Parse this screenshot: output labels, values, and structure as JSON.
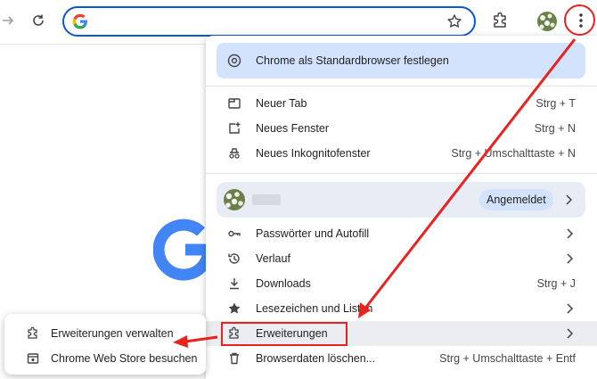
{
  "toolbar": {
    "omnibox_value": "",
    "icons": [
      "forward-icon",
      "reload-icon",
      "google-g-icon",
      "bookmark-star-icon",
      "extensions-icon",
      "profile-avatar",
      "more-menu-icon"
    ]
  },
  "menu": {
    "default_banner": "Chrome als Standardbrowser festlegen",
    "items_group1": [
      {
        "label": "Neuer Tab",
        "shortcut": "Strg + T",
        "icon": "new-tab-icon"
      },
      {
        "label": "Neues Fenster",
        "shortcut": "Strg + N",
        "icon": "new-window-icon"
      },
      {
        "label": "Neues Inkognitofenster",
        "shortcut": "Strg + Umschalttaste + N",
        "icon": "incognito-icon"
      }
    ],
    "profile": {
      "name": "",
      "status_badge": "Angemeldet"
    },
    "items_group2": [
      {
        "label": "Passwörter und Autofill",
        "shortcut": "",
        "icon": "key-icon",
        "submenu": true
      },
      {
        "label": "Verlauf",
        "shortcut": "",
        "icon": "history-icon",
        "submenu": true
      },
      {
        "label": "Downloads",
        "shortcut": "Strg + J",
        "icon": "download-icon",
        "submenu": false
      },
      {
        "label": "Lesezeichen und Listen",
        "shortcut": "",
        "icon": "star-icon",
        "submenu": true
      },
      {
        "label": "Erweiterungen",
        "shortcut": "",
        "icon": "extensions-icon",
        "submenu": true
      },
      {
        "label": "Browserdaten löschen...",
        "shortcut": "Strg + Umschalttaste + Entf",
        "icon": "trash-icon",
        "submenu": false
      }
    ]
  },
  "submenu": {
    "items": [
      {
        "label": "Erweiterungen verwalten",
        "icon": "extensions-icon"
      },
      {
        "label": "Chrome Web Store besuchen",
        "icon": "web-store-icon"
      }
    ]
  },
  "colors": {
    "accent_blue": "#0b57d0",
    "banner_bg": "#d3e3fd",
    "annotation_red": "#e8231f"
  }
}
